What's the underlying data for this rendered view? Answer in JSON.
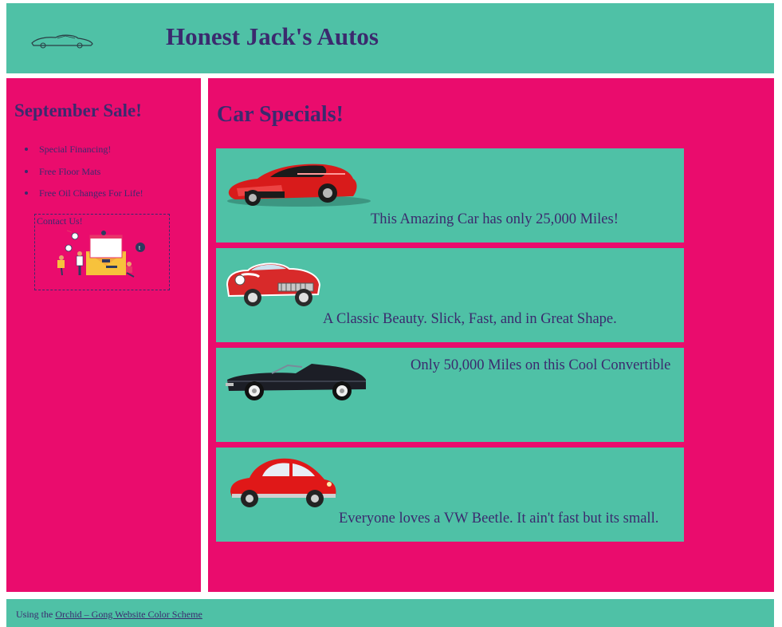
{
  "header": {
    "title": "Honest Jack's Autos"
  },
  "sidebar": {
    "heading": "September Sale!",
    "items": [
      "Special Financing!",
      "Free Floor Mats",
      "Free Oil Changes For Life!"
    ],
    "contact_label": "Contact Us!"
  },
  "main": {
    "heading": "Car Specials!",
    "cards": [
      {
        "caption": "This Amazing Car has only 25,000 Miles!",
        "icon": "red-sports-car-icon"
      },
      {
        "caption": "A Classic Beauty. Slick, Fast, and in Great Shape.",
        "icon": "classic-red-car-icon"
      },
      {
        "caption": "Only 50,000 Miles on this Cool Convertible",
        "icon": "black-convertible-icon"
      },
      {
        "caption": "Everyone loves a VW Beetle. It ain't fast but its small.",
        "icon": "red-beetle-icon"
      }
    ]
  },
  "footer": {
    "prefix": "Using the ",
    "link_text": "Orchid – Gong Website Color Scheme"
  },
  "colors": {
    "teal": "#4fc1a6",
    "pink": "#ea0c6d",
    "text": "#3b2a6e"
  }
}
